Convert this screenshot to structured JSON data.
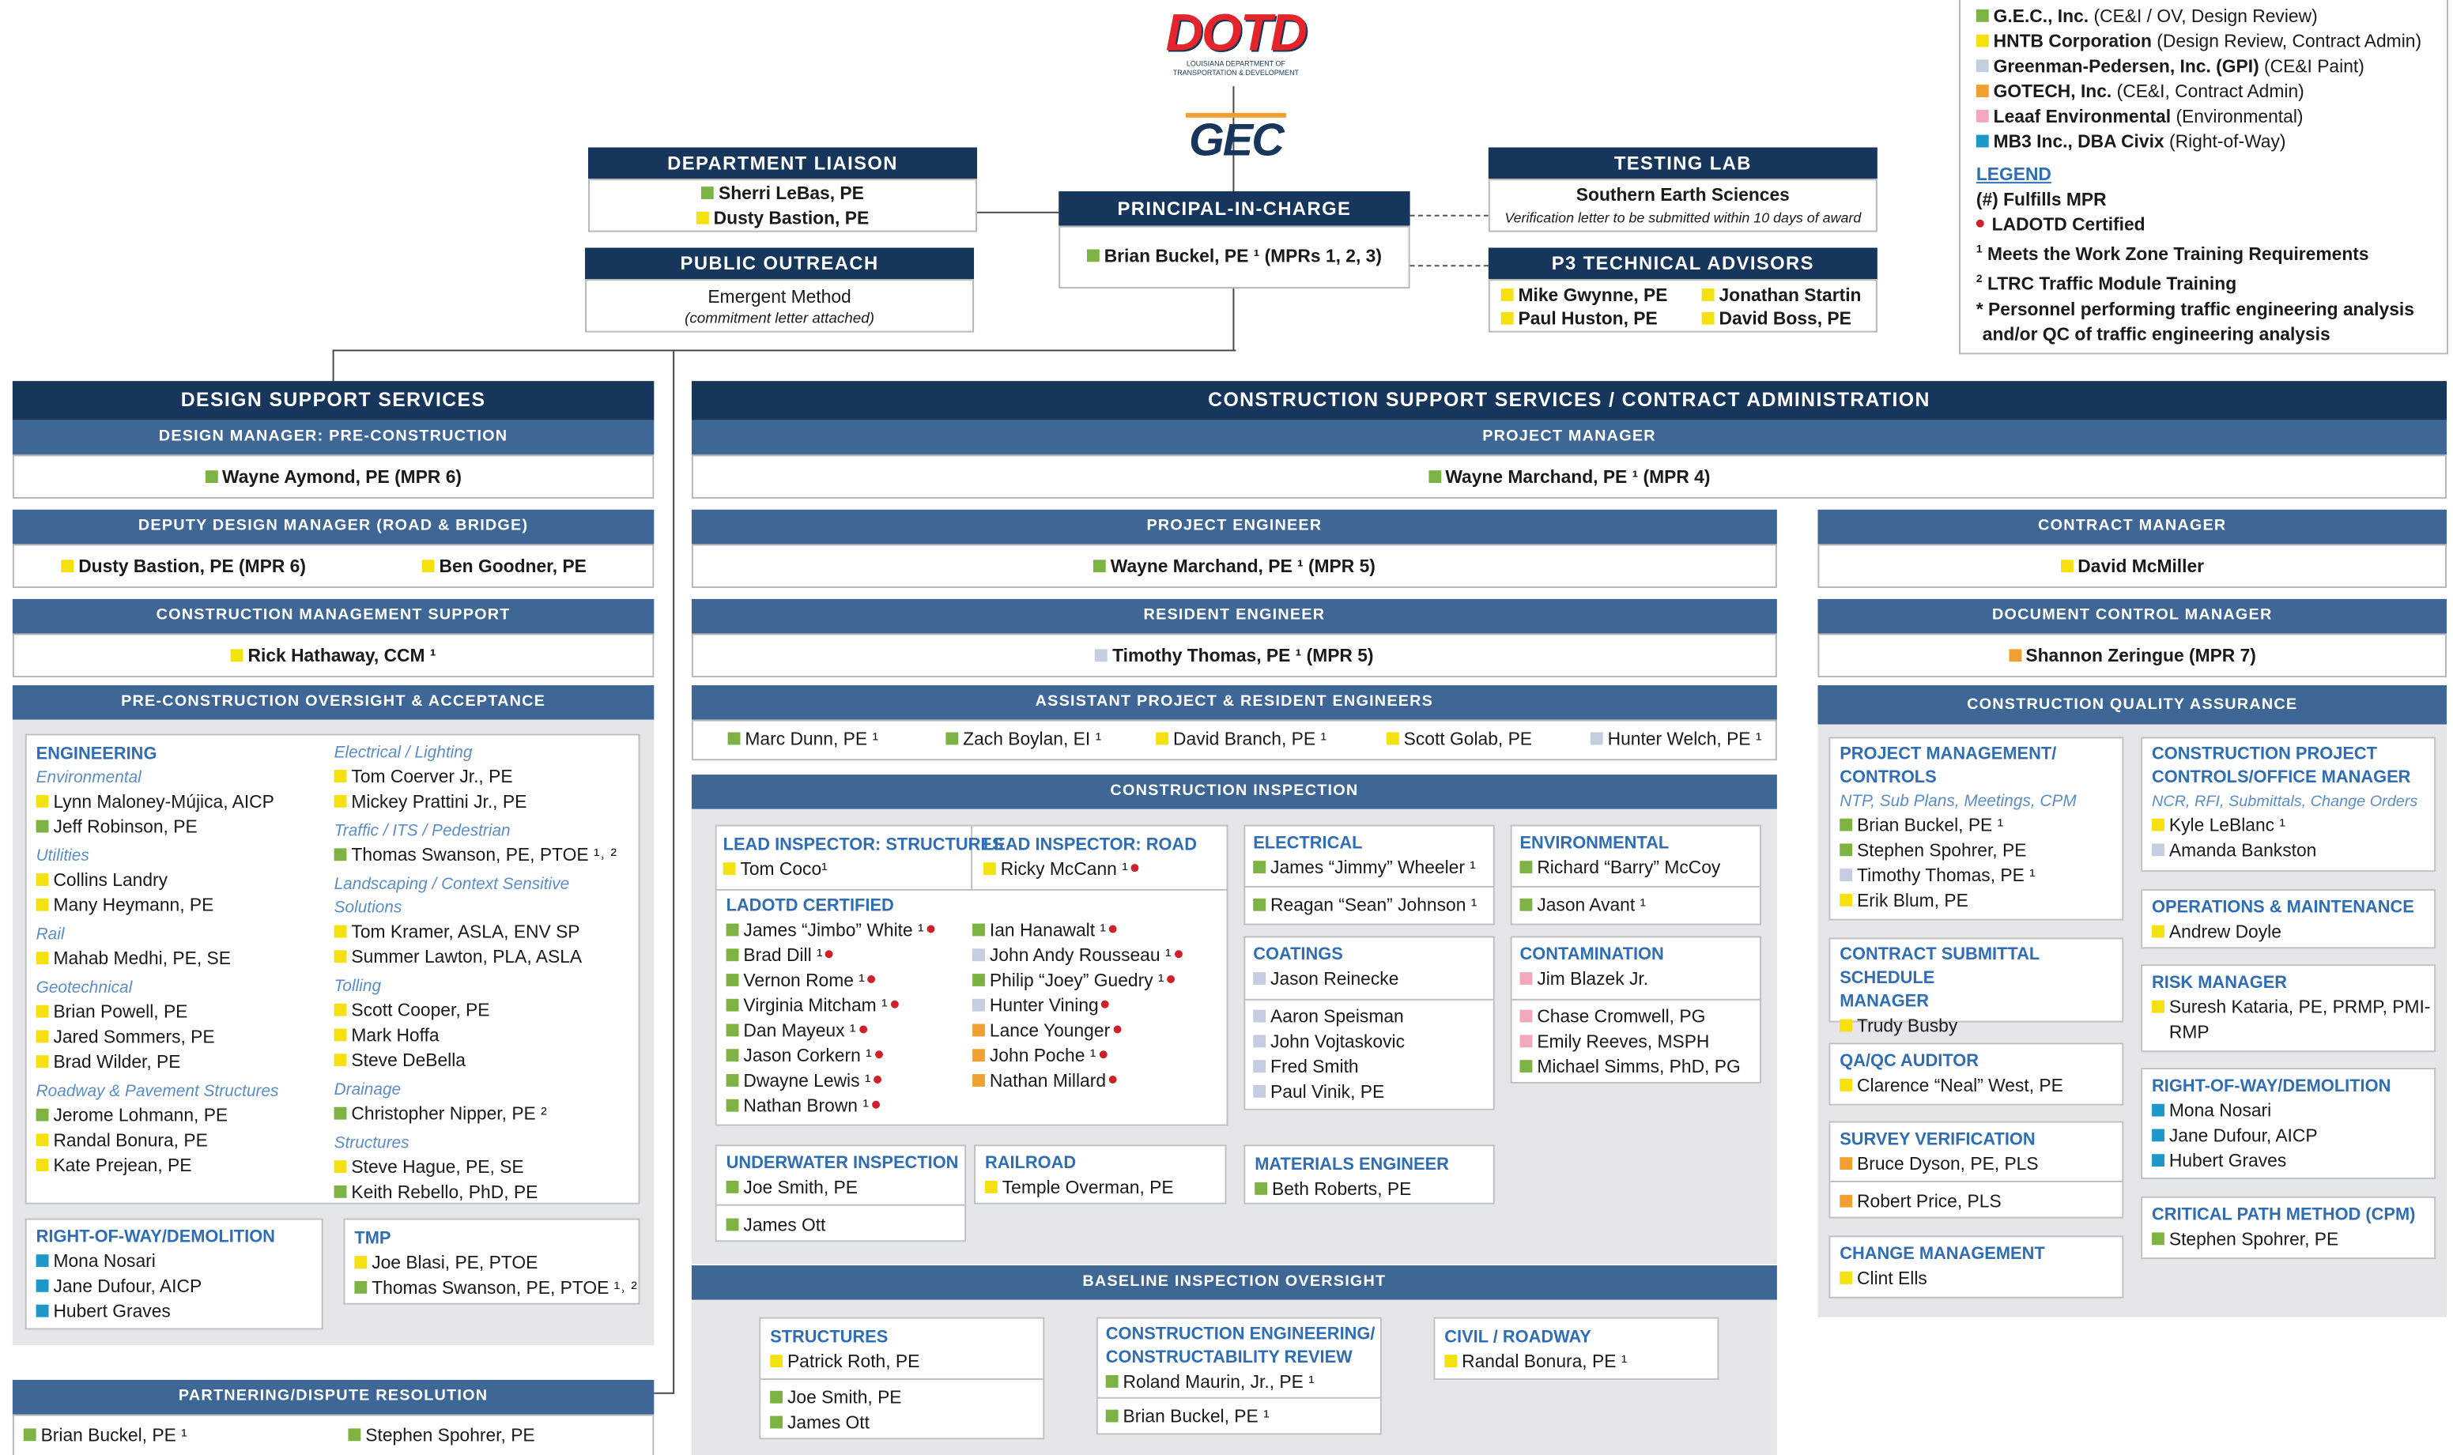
{
  "logo": {
    "dotd": "DOTD",
    "dotd_sub": "LOUISIANA DEPARTMENT OF TRANSPORTATION & DEVELOPMENT",
    "gec": "GEC"
  },
  "colors": {
    "navy": "#16365c",
    "subheader": "#3f6795",
    "accent_text": "#2f6db5",
    "gec_green": "#7cb342",
    "hntb_yellow": "#f4e10f",
    "gpi_gray": "#c5cde0",
    "gotech_orange": "#f0a030",
    "leaaf_pink": "#f3a7bd",
    "mb3_blue": "#1d98c9",
    "certified_red": "#d0202a"
  },
  "firms": [
    {
      "color": "green",
      "name": "G.E.C., Inc.",
      "role": "(CE&I / OV, Design Review)"
    },
    {
      "color": "yellow",
      "name": "HNTB Corporation",
      "role": "(Design Review, Contract Admin)"
    },
    {
      "color": "gray",
      "name": "Greenman-Pedersen, Inc. (GPI)",
      "role": "(CE&I Paint)"
    },
    {
      "color": "orange",
      "name": "GOTECH, Inc.",
      "role": "(CE&I, Contract Admin)"
    },
    {
      "color": "pink",
      "name": "Leaaf Environmental",
      "role": "(Environmental)"
    },
    {
      "color": "blue",
      "name": "MB3 Inc., DBA Civix",
      "role": "(Right-of-Way)"
    }
  ],
  "legend": {
    "title": "LEGEND",
    "mpr": "(#) Fulfills MPR",
    "certified": "LADOTD Certified",
    "note1": "Meets the Work Zone Training Requirements",
    "note2": "LTRC Traffic Module Training",
    "note3a": "* Personnel performing traffic engineering analysis",
    "note3b": "and/or QC of traffic engineering analysis"
  },
  "top": {
    "liaison": {
      "title": "DEPARTMENT LIAISON",
      "p1": "Sherri LeBas, PE",
      "p2": "Dusty Bastion, PE"
    },
    "outreach": {
      "title": "PUBLIC OUTREACH",
      "org": "Emergent Method",
      "note": "(commitment letter attached)"
    },
    "principal": {
      "title": "PRINCIPAL-IN-CHARGE",
      "name": "Brian Buckel, PE ¹ (MPRs 1, 2, 3)"
    },
    "testing": {
      "title": "TESTING LAB",
      "org": "Southern Earth Sciences",
      "note": "Verification letter to be submitted within 10 days of award"
    },
    "p3": {
      "title": "P3 TECHNICAL ADVISORS",
      "a": "Mike Gwynne, PE",
      "b": "Jonathan Startin",
      "c": "Paul Huston, PE",
      "d": "David Boss, PE"
    }
  },
  "design": {
    "title": "DESIGN SUPPORT SERVICES",
    "dm_title": "DESIGN MANAGER: PRE-CONSTRUCTION",
    "dm_name": "Wayne Aymond, PE (MPR 6)",
    "ddm_title": "DEPUTY DESIGN MANAGER (ROAD & BRIDGE)",
    "ddm_a": "Dusty Bastion, PE (MPR 6)",
    "ddm_b": "Ben Goodner, PE",
    "cms_title": "CONSTRUCTION MANAGEMENT SUPPORT",
    "cms_name": "Rick Hathaway, CCM ¹",
    "pre_title": "PRE-CONSTRUCTION OVERSIGHT & ACCEPTANCE",
    "eng": "ENGINEERING",
    "env": "Environmental",
    "env1": "Lynn Maloney-Mújica, AICP",
    "env2": "Jeff Robinson, PE",
    "util": "Utilities",
    "util1": "Collins Landry",
    "util2": "Many Heymann, PE",
    "rail": "Rail",
    "rail1": "Mahab Medhi, PE, SE",
    "geo": "Geotechnical",
    "geo1": "Brian Powell, PE",
    "geo2": "Jared Sommers, PE",
    "geo3": "Brad Wilder, PE",
    "road": "Roadway & Pavement Structures",
    "road1": "Jerome Lohmann, PE",
    "road2": "Randal Bonura, PE",
    "road3": "Kate Prejean, PE",
    "elec": "Electrical / Lighting",
    "elec1": "Tom Coerver Jr., PE",
    "elec2": "Mickey Prattini Jr., PE",
    "traf": "Traffic / ITS / Pedestrian",
    "traf1": "Thomas Swanson, PE, PTOE ¹˒ ²",
    "land": "Landscaping / Context Sensitive Solutions",
    "land1": "Tom Kramer, ASLA, ENV SP",
    "land2": "Summer Lawton, PLA, ASLA",
    "toll": "Tolling",
    "toll1": "Scott Cooper, PE",
    "toll2": "Mark Hoffa",
    "toll3": "Steve DeBella",
    "drain": "Drainage",
    "drain1": "Christopher Nipper, PE ²",
    "struct": "Structures",
    "struct1": "Steve Hague, PE, SE",
    "struct2": "Keith Rebello, PhD, PE",
    "row": "RIGHT-OF-WAY/DEMOLITION",
    "row1": "Mona Nosari",
    "row2": "Jane Dufour, AICP",
    "row3": "Hubert Graves",
    "tmp": "TMP",
    "tmp1": "Joe Blasi, PE, PTOE",
    "tmp2": "Thomas Swanson, PE, PTOE ¹˒ ²",
    "part_title": "PARTNERING/DISPUTE RESOLUTION",
    "part1": "Brian Buckel, PE ¹",
    "part2": "Stephen Spohrer, PE"
  },
  "construction": {
    "title": "CONSTRUCTION SUPPORT SERVICES / CONTRACT ADMINISTRATION",
    "pm_title": "PROJECT MANAGER",
    "pm_name": "Wayne Marchand, PE ¹ (MPR 4)",
    "pe_title": "PROJECT ENGINEER",
    "pe_name": "Wayne Marchand, PE ¹ (MPR 5)",
    "re_title": "RESIDENT ENGINEER",
    "re_name": "Timothy Thomas, PE ¹ (MPR 5)",
    "ape_title": "ASSISTANT PROJECT & RESIDENT ENGINEERS",
    "ape1": "Marc Dunn, PE ¹",
    "ape2": "Zach Boylan, EI ¹",
    "ape3": "David Branch, PE ¹",
    "ape4": "Scott Golab, PE",
    "ape5": "Hunter Welch, PE ¹",
    "ci_title": "CONSTRUCTION INSPECTION",
    "lis": "LEAD INSPECTOR: STRUCTURES",
    "lis1": "Tom Coco¹",
    "lir": "LEAD INSPECTOR: ROAD",
    "lir1": "Ricky McCann ¹",
    "cert": "LADOTD CERTIFIED",
    "c1": "James “Jimbo” White ¹",
    "c2": "Brad Dill ¹",
    "c3": "Vernon Rome ¹",
    "c4": "Virginia Mitcham ¹",
    "c5": "Dan Mayeux ¹",
    "c6": "Jason Corkern ¹",
    "c7": "Dwayne Lewis ¹",
    "c8": "Nathan Brown ¹",
    "c9": "Ian Hanawalt ¹",
    "c10": "John Andy Rousseau ¹",
    "c11": "Philip “Joey” Guedry ¹",
    "c12": "Hunter Vining",
    "c13": "Lance Younger",
    "c14": "John Poche ¹",
    "c15": "Nathan Millard",
    "elec": "ELECTRICAL",
    "elec1": "James “Jimmy” Wheeler ¹",
    "elec2": "Reagan “Sean” Johnson ¹",
    "envr": "ENVIRONMENTAL",
    "envr1": "Richard “Barry” McCoy",
    "envr2": "Jason Avant ¹",
    "coat": "COATINGS",
    "coat1": "Jason Reinecke",
    "coat2": "Aaron Speisman",
    "coat3": "John Vojtaskovic",
    "coat4": "Fred Smith",
    "coat5": "Paul Vinik, PE",
    "cont": "CONTAMINATION",
    "cont1": "Jim Blazek Jr.",
    "cont2": "Chase Cromwell, PG",
    "cont3": "Emily Reeves, MSPH",
    "cont4": "Michael Simms, PhD, PG",
    "uw": "UNDERWATER INSPECTION",
    "uw1": "Joe Smith, PE",
    "uw2": "James Ott",
    "rr": "RAILROAD",
    "rr1": "Temple Overman, PE",
    "mat": "MATERIALS ENGINEER",
    "mat1": "Beth Roberts, PE",
    "bio_title": "BASELINE INSPECTION OVERSIGHT",
    "bs": "STRUCTURES",
    "bs1": "Patrick Roth, PE",
    "bs2": "Joe Smith, PE",
    "bs3": "James Ott",
    "bce": "CONSTRUCTION ENGINEERING/",
    "bce_b": "CONSTRUCTABILITY REVIEW",
    "bce1": "Roland Maurin, Jr., PE ¹",
    "bce2": "Brian Buckel, PE ¹",
    "bcr": "CIVIL / ROADWAY",
    "bcr1": "Randal Bonura, PE ¹",
    "cm_title": "CONTRACT MANAGER",
    "cm_name": "David McMiller",
    "dcm_title": "DOCUMENT CONTROL MANAGER",
    "dcm_name": "Shannon Zeringue (MPR 7)",
    "cqa_title": "CONSTRUCTION QUALITY ASSURANCE",
    "pmc": "PROJECT MANAGEMENT/",
    "pmc_b": "CONTROLS",
    "pmc_i": "NTP, Sub Plans, Meetings, CPM",
    "pmc1": "Brian Buckel, PE ¹",
    "pmc2": "Stephen Spohrer, PE",
    "pmc3": "Timothy Thomas, PE ¹",
    "pmc4": "Erik Blum, PE",
    "cpo": "CONSTRUCTION PROJECT",
    "cpo_b": "CONTROLS/OFFICE MANAGER",
    "cpo_i": "NCR, RFI, Submittals, Change Orders",
    "cpo1": "Kyle LeBlanc ¹",
    "cpo2": "Amanda Bankston",
    "css": "CONTRACT SUBMITTAL SCHEDULE",
    "css_b": "MANAGER",
    "css1": "Trudy Busby",
    "om": "OPERATIONS & MAINTENANCE",
    "om1": "Andrew Doyle",
    "qa": "QA/QC AUDITOR",
    "qa1": "Clarence “Neal” West, PE",
    "rm": "RISK MANAGER",
    "rm1": "Suresh Kataria, PE, PRMP, PMI-",
    "rm1b": "RMP",
    "sv": "SURVEY VERIFICATION",
    "sv1": "Bruce Dyson, PE, PLS",
    "sv2": "Robert Price, PLS",
    "row": "RIGHT-OF-WAY/DEMOLITION",
    "row1": "Mona Nosari",
    "row2": "Jane Dufour, AICP",
    "row3": "Hubert Graves",
    "chm": "CHANGE MANAGEMENT",
    "chm1": "Clint Ells",
    "cpm": "CRITICAL PATH METHOD (CPM)",
    "cpm1": "Stephen Spohrer, PE"
  }
}
